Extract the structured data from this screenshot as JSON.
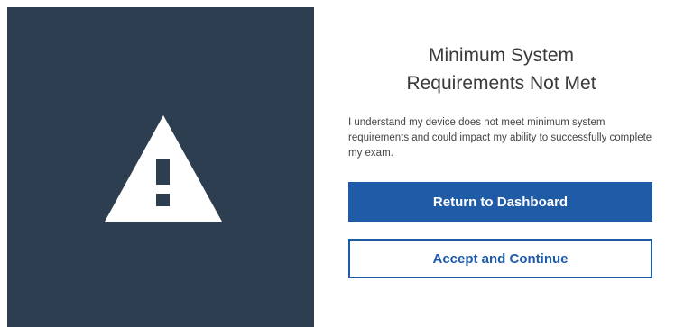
{
  "dialog": {
    "title_line1": "Minimum System",
    "title_line2": "Requirements Not Met",
    "message": "I understand my device does not meet minimum system requirements and could impact my ability to successfully complete my exam.",
    "primary_button_label": "Return to Dashboard",
    "secondary_button_label": "Accept and Continue"
  },
  "icons": {
    "warning": "warning-triangle-icon"
  },
  "colors": {
    "left_panel_bg": "#2d3e50",
    "accent": "#1f5ba6",
    "icon": "#ffffff",
    "title_text": "#3a3a3a",
    "body_text": "#444444"
  }
}
